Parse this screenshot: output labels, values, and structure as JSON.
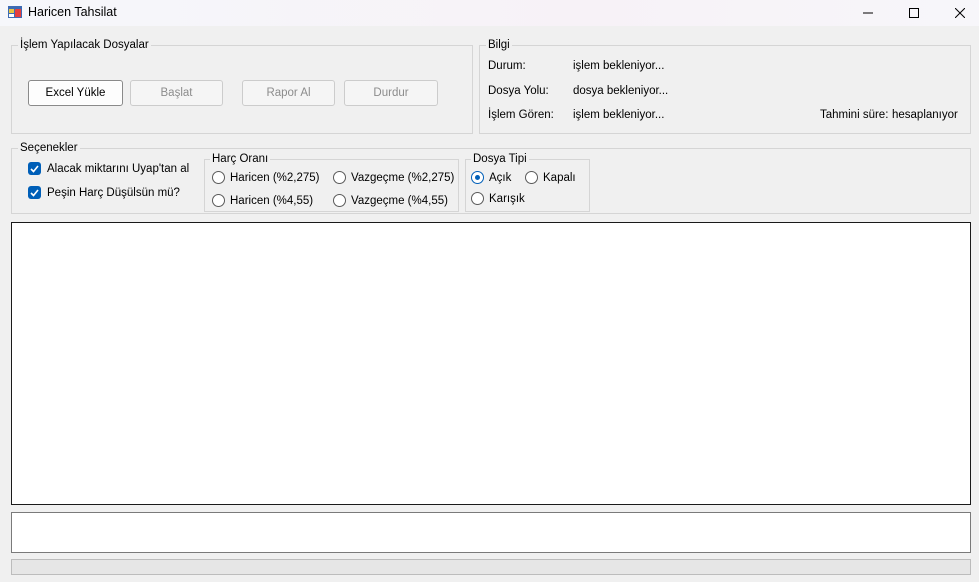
{
  "window": {
    "title": "Haricen Tahsilat",
    "controls": [
      "minimize-icon",
      "maximize-icon",
      "close-icon"
    ]
  },
  "files_group": {
    "legend": "İşlem Yapılacak Dosyalar",
    "buttons": {
      "excel": "Excel Yükle",
      "start": "Başlat",
      "report": "Rapor Al",
      "stop": "Durdur"
    }
  },
  "info_group": {
    "legend": "Bilgi",
    "status_label": "Durum:",
    "status_value": "işlem bekleniyor...",
    "path_label": "Dosya Yolu:",
    "path_value": "dosya bekleniyor...",
    "processed_label": "İşlem Gören:",
    "processed_value": "işlem bekleniyor...",
    "eta_label": "Tahmini süre:",
    "eta_value": "hesaplanıyor"
  },
  "options_group": {
    "legend": "Seçenekler",
    "checkboxes": [
      {
        "label": "Alacak miktarını Uyap'tan al",
        "checked": true
      },
      {
        "label": "Peşin Harç Düşülsün mü?",
        "checked": true
      }
    ]
  },
  "fee_group": {
    "legend": "Harç Oranı",
    "options": [
      {
        "label": "Haricen (%2,275)",
        "selected": false
      },
      {
        "label": "Vazgeçme (%2,275)",
        "selected": false
      },
      {
        "label": "Haricen (%4,55)",
        "selected": false
      },
      {
        "label": "Vazgeçme (%4,55)",
        "selected": false
      }
    ]
  },
  "file_type_group": {
    "legend": "Dosya Tipi",
    "options": [
      {
        "label": "Açık",
        "selected": true
      },
      {
        "label": "Kapalı",
        "selected": false
      },
      {
        "label": "Karışık",
        "selected": false
      }
    ]
  },
  "log": {
    "text": ""
  },
  "input": {
    "value": ""
  },
  "progress": {
    "percent": 0
  },
  "colors": {
    "accent": "#005fb8",
    "background": "#f0f0f0"
  }
}
